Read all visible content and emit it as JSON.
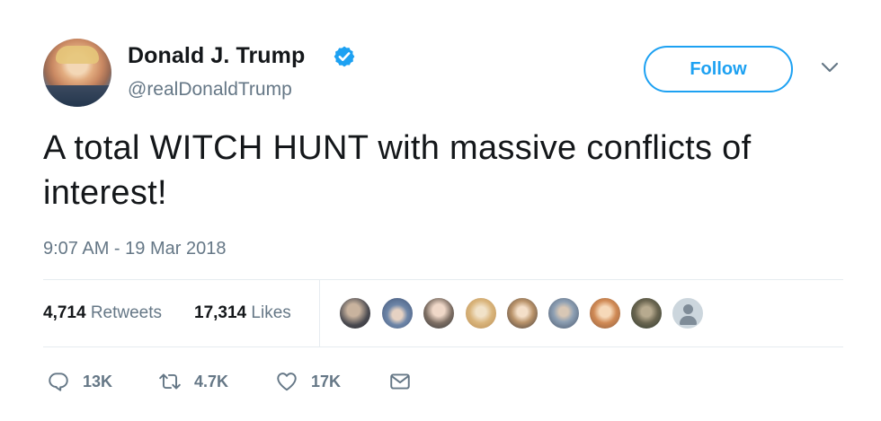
{
  "user": {
    "name": "Donald J. Trump",
    "handle": "@realDonaldTrump",
    "verified": true,
    "verified_icon": "verified-badge-icon"
  },
  "follow_button": {
    "label": "Follow"
  },
  "menu_icon": "chevron-down-icon",
  "tweet": {
    "text": "A total WITCH HUNT with massive conflicts of interest!",
    "timestamp": "9:07 AM - 19 Mar 2018"
  },
  "stats": {
    "retweets_count": "4,714",
    "retweets_label": "Retweets",
    "likes_count": "17,314",
    "likes_label": "Likes"
  },
  "likers_shown": 9,
  "actions": {
    "reply": {
      "icon": "reply-icon",
      "count": "13K"
    },
    "retweet": {
      "icon": "retweet-icon",
      "count": "4.7K"
    },
    "like": {
      "icon": "heart-icon",
      "count": "17K"
    },
    "message": {
      "icon": "envelope-icon"
    }
  },
  "colors": {
    "accent": "#1da1f2",
    "text": "#14171a",
    "secondary": "#657786",
    "divider": "#e6ecf0"
  }
}
